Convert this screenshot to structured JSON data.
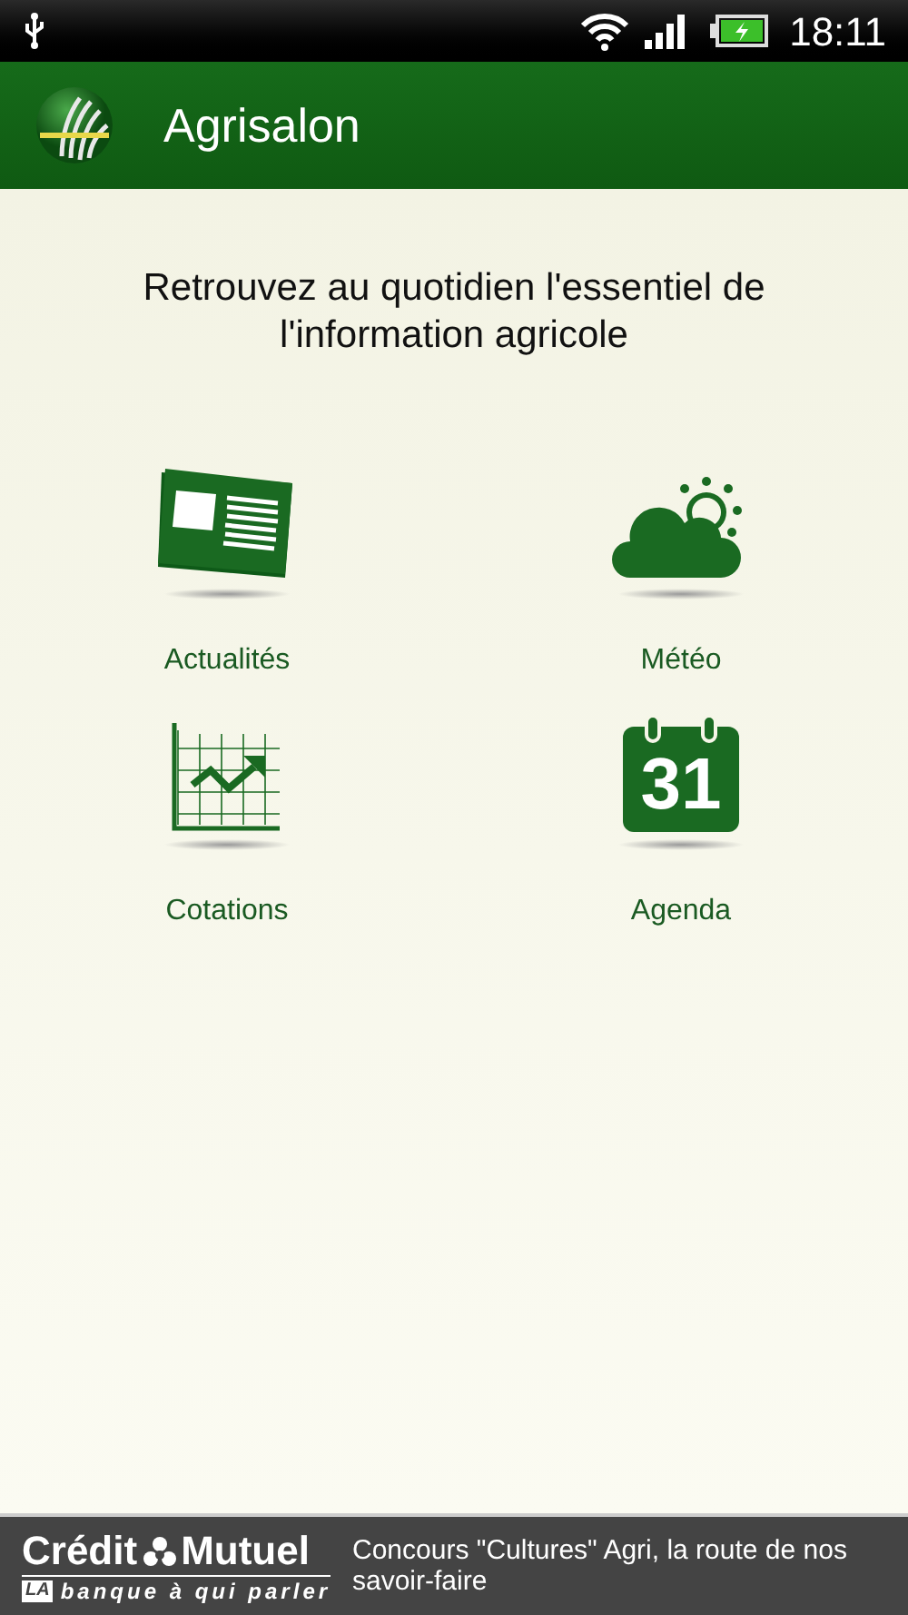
{
  "status_bar": {
    "time": "18:11"
  },
  "app_bar": {
    "title": "Agrisalon"
  },
  "intro": "Retrouvez au quotidien l'essentiel de l'information agricole",
  "menu": [
    {
      "kind": "news",
      "label": "Actualités"
    },
    {
      "kind": "weather",
      "label": "Météo"
    },
    {
      "kind": "chart",
      "label": "Cotations"
    },
    {
      "kind": "calendar",
      "label": "Agenda"
    }
  ],
  "calendar_icon": {
    "day": "31"
  },
  "ad_banner": {
    "brand_left": "Crédit",
    "brand_right": "Mutuel",
    "tag_badge": "LA",
    "tagline": "banque à qui parler",
    "message": "Concours \"Cultures\" Agri, la route de nos savoir-faire"
  }
}
